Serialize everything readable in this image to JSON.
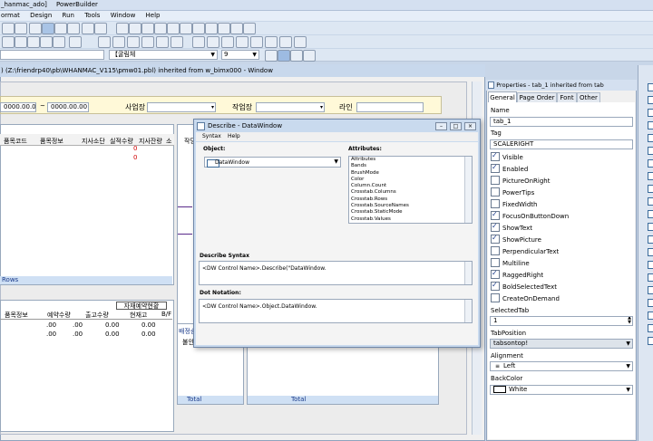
{
  "app": {
    "title_fragment": "_hanmac_ado]",
    "title_app": "PowerBuilder",
    "menu": [
      "ormat",
      "Design",
      "Run",
      "Tools",
      "Window",
      "Help"
    ]
  },
  "toolbar": {
    "font_name": "【굴림체",
    "font_size": "9"
  },
  "child_window": {
    "title": ") (Z:\\friendrp40\\pb\\WHANMAC_V115\\pmw01.pbl) inherited from w_bimx000 - Window"
  },
  "form": {
    "date_from": "0000.00.00",
    "tilde": "~",
    "date_to": "0000.00.00",
    "site_label": "사업장",
    "work_site_label": "작업장",
    "line_label": "라인"
  },
  "grid_top": {
    "headers": [
      "품목코드",
      "품목정보",
      "지사소단",
      "실적수량",
      "지사잔량",
      "소"
    ],
    "row1_value": "0",
    "row2_value": "0",
    "rows_label": "Rows"
  },
  "grid_bottom": {
    "group_header": "자재예약현황",
    "headers": [
      "품목정보",
      "예약수량",
      "출고수량",
      "현재고",
      "B/F"
    ],
    "row1": [
      ".00",
      ".00",
      "0.00",
      "0.00"
    ],
    "row2": [
      ".00",
      ".00",
      "0.00",
      "0.00"
    ]
  },
  "mid_panels": {
    "panel1_header": "작당",
    "panel2_header": "배정송",
    "panel2_sub": "불안",
    "total1": "Total",
    "total2": "Total"
  },
  "describe_dialog": {
    "title": "Describe - DataWindow",
    "menu": [
      "Syntax",
      "Help"
    ],
    "object_label": "Object:",
    "object_value": "DataWindow",
    "attributes_label": "Attributes:",
    "attributes": [
      "Attributes",
      "Bands",
      "BrushMode",
      "Color",
      "Column.Count",
      "Crosstab.Columns",
      "Crosstab.Rows",
      "Crosstab.SourceNames",
      "Crosstab.StaticMode",
      "Crosstab.Values"
    ],
    "describe_syntax_label": "Describe Syntax",
    "describe_syntax_value": "<DW Control Name>.Describe(\"DataWindow.",
    "dot_notation_label": "Dot Notation:",
    "dot_notation_value": "<DW Control Name>.Object.DataWindow."
  },
  "properties": {
    "title": "Properties - tab_1 inherited from tab",
    "tabs": [
      "General",
      "Page Order",
      "Font",
      "Other"
    ],
    "name_label": "Name",
    "name_value": "tab_1",
    "tag_label": "Tag",
    "tag_value": "SCALERIGHT",
    "checkboxes": [
      {
        "label": "Visible",
        "checked": true
      },
      {
        "label": "Enabled",
        "checked": true
      },
      {
        "label": "PictureOnRight",
        "checked": false
      },
      {
        "label": "PowerTips",
        "checked": false
      },
      {
        "label": "FixedWidth",
        "checked": false
      },
      {
        "label": "FocusOnButtonDown",
        "checked": true
      },
      {
        "label": "ShowText",
        "checked": true
      },
      {
        "label": "ShowPicture",
        "checked": true
      },
      {
        "label": "PerpendicularText",
        "checked": false
      },
      {
        "label": "Multiline",
        "checked": false
      },
      {
        "label": "RaggedRight",
        "checked": true
      },
      {
        "label": "BoldSelectedText",
        "checked": true
      },
      {
        "label": "CreateOnDemand",
        "checked": false
      }
    ],
    "selected_tab_label": "SelectedTab",
    "selected_tab_value": "1",
    "tab_position_label": "TabPosition",
    "tab_position_value": "tabsontop!",
    "alignment_label": "Alignment",
    "alignment_value": "Left",
    "backcolor_label": "BackColor",
    "backcolor_value": "White"
  },
  "colors": {
    "desktop": "#c8d6e8",
    "title_gradient": "#dbe6f4",
    "grid_blue_bar": "#cfe0f4",
    "red_value": "#d00000",
    "selected_blue": "#3a6ea5"
  }
}
